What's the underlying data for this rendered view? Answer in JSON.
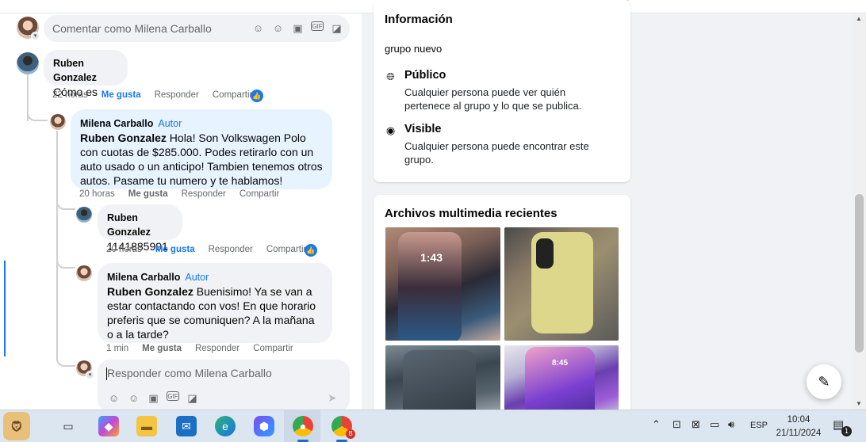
{
  "main_comment_input": {
    "placeholder": "Comentar como Milena Carballo"
  },
  "comments": [
    {
      "author": "Ruben Gonzalez",
      "text": "Cómo es",
      "time": "22 horas",
      "like": "Me gusta",
      "reply": "Responder",
      "share": "Compartir"
    },
    {
      "author": "Milena Carballo",
      "badge": "Autor",
      "mention": "Ruben Gonzalez",
      "text": "Hola! Son Volkswagen Polo con cuotas de $285.000. Podes retirarlo con un auto usado o un anticipo! Tambien tenemos otros autos. Pasame tu numero y te hablamos!",
      "time": "20 horas",
      "like": "Me gusta",
      "reply": "Responder",
      "share": "Compartir"
    },
    {
      "author": "Ruben Gonzalez",
      "text": "1141885991",
      "time": "20 horas",
      "like": "Me gusta",
      "reply": "Responder",
      "share": "Compartir"
    },
    {
      "author": "Milena Carballo",
      "badge": "Autor",
      "mention": "Ruben Gonzalez",
      "text": "Buenisimo! Ya se van a estar contactando con vos! En que horario preferis que se comuniquen? A la mañana o a la tarde?",
      "time": "1 min",
      "like": "Me gusta",
      "reply": "Responder",
      "share": "Compartir"
    }
  ],
  "reply_input": {
    "placeholder": "Responder como Milena Carballo"
  },
  "info": {
    "title": "Información",
    "description": "grupo nuevo",
    "rows": [
      {
        "icon": "globe-icon",
        "title": "Público",
        "desc": "Cualquier persona puede ver quién pertenece al grupo y lo que se publica."
      },
      {
        "icon": "eye-icon",
        "title": "Visible",
        "desc": "Cualquier persona puede encontrar este grupo."
      }
    ]
  },
  "media": {
    "title": "Archivos multimedia recientes",
    "photos": [
      {
        "screen_time": "1:43"
      },
      {
        "screen_time": ""
      },
      {
        "screen_time": ""
      },
      {
        "screen_time": "8:45"
      }
    ]
  },
  "taskbar": {
    "language": "ESP",
    "time": "10:04",
    "date": "21/11/2024",
    "notification_count": "1",
    "chrome_profile_badge": "B"
  },
  "colors": {
    "accent": "#1877f2",
    "author_bubble": "#e7f3ff",
    "bubble": "#f0f2f5",
    "page_bg": "#f0f2f5"
  }
}
